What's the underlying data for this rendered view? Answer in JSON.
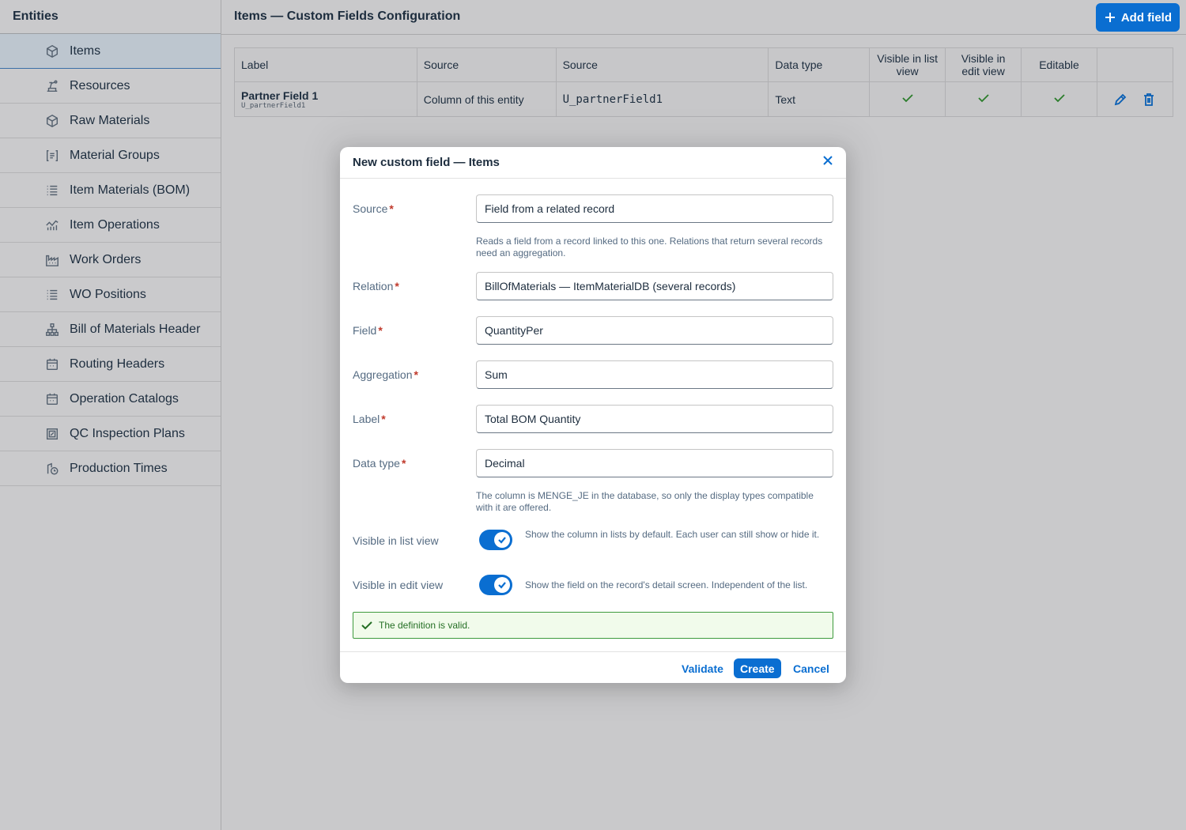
{
  "sidebar": {
    "title": "Entities",
    "items": [
      {
        "label": "Items",
        "icon": "cube-icon",
        "active": true
      },
      {
        "label": "Resources",
        "icon": "machine-icon"
      },
      {
        "label": "Raw Materials",
        "icon": "cube-icon"
      },
      {
        "label": "Material Groups",
        "icon": "group-icon"
      },
      {
        "label": "Item Materials (BOM)",
        "icon": "list-icon"
      },
      {
        "label": "Item Operations",
        "icon": "chart-icon"
      },
      {
        "label": "Work Orders",
        "icon": "factory-icon"
      },
      {
        "label": "WO Positions",
        "icon": "list-icon"
      },
      {
        "label": "Bill of Materials Header",
        "icon": "hierarchy-icon"
      },
      {
        "label": "Routing Headers",
        "icon": "calendar-icon"
      },
      {
        "label": "Operation Catalogs",
        "icon": "calendar-icon"
      },
      {
        "label": "QC Inspection Plans",
        "icon": "inspection-icon"
      },
      {
        "label": "Production Times",
        "icon": "clock-icon"
      }
    ]
  },
  "header": {
    "title": "Items — Custom Fields Configuration",
    "add_label": "Add field"
  },
  "table": {
    "columns": [
      "Label",
      "Source",
      "Source",
      "Data type",
      "Visible in list view",
      "Visible in edit view",
      "Editable"
    ],
    "row": {
      "label": "Partner Field 1",
      "label_sub": "U_partnerField1",
      "source": "Column of this entity",
      "source_field": "U_partnerField1",
      "data_type": "Text"
    }
  },
  "dialog": {
    "title": "New custom field — Items",
    "source_label": "Source",
    "source_value": "Field from a related record",
    "source_hint": "Reads a field from a record linked to this one. Relations that return several records need an aggregation.",
    "relation_label": "Relation",
    "relation_value": "BillOfMaterials — ItemMaterialDB (several records)",
    "field_label": "Field",
    "field_value": "QuantityPer",
    "aggregation_label": "Aggregation",
    "aggregation_value": "Sum",
    "label_label": "Label",
    "label_value": "Total BOM Quantity",
    "datatype_label": "Data type",
    "datatype_value": "Decimal",
    "datatype_hint": "The column is MENGE_JE in the database, so only the display types compatible with it are offered.",
    "visible_list_label": "Visible in list view",
    "visible_list_desc": "Show the column in lists by default. Each user can still show or hide it.",
    "visible_edit_label": "Visible in edit view",
    "visible_edit_desc": "Show the field on the record's detail screen. Independent of the list.",
    "valid_message": "The definition is valid.",
    "validate_label": "Validate",
    "create_label": "Create",
    "cancel_label": "Cancel"
  }
}
